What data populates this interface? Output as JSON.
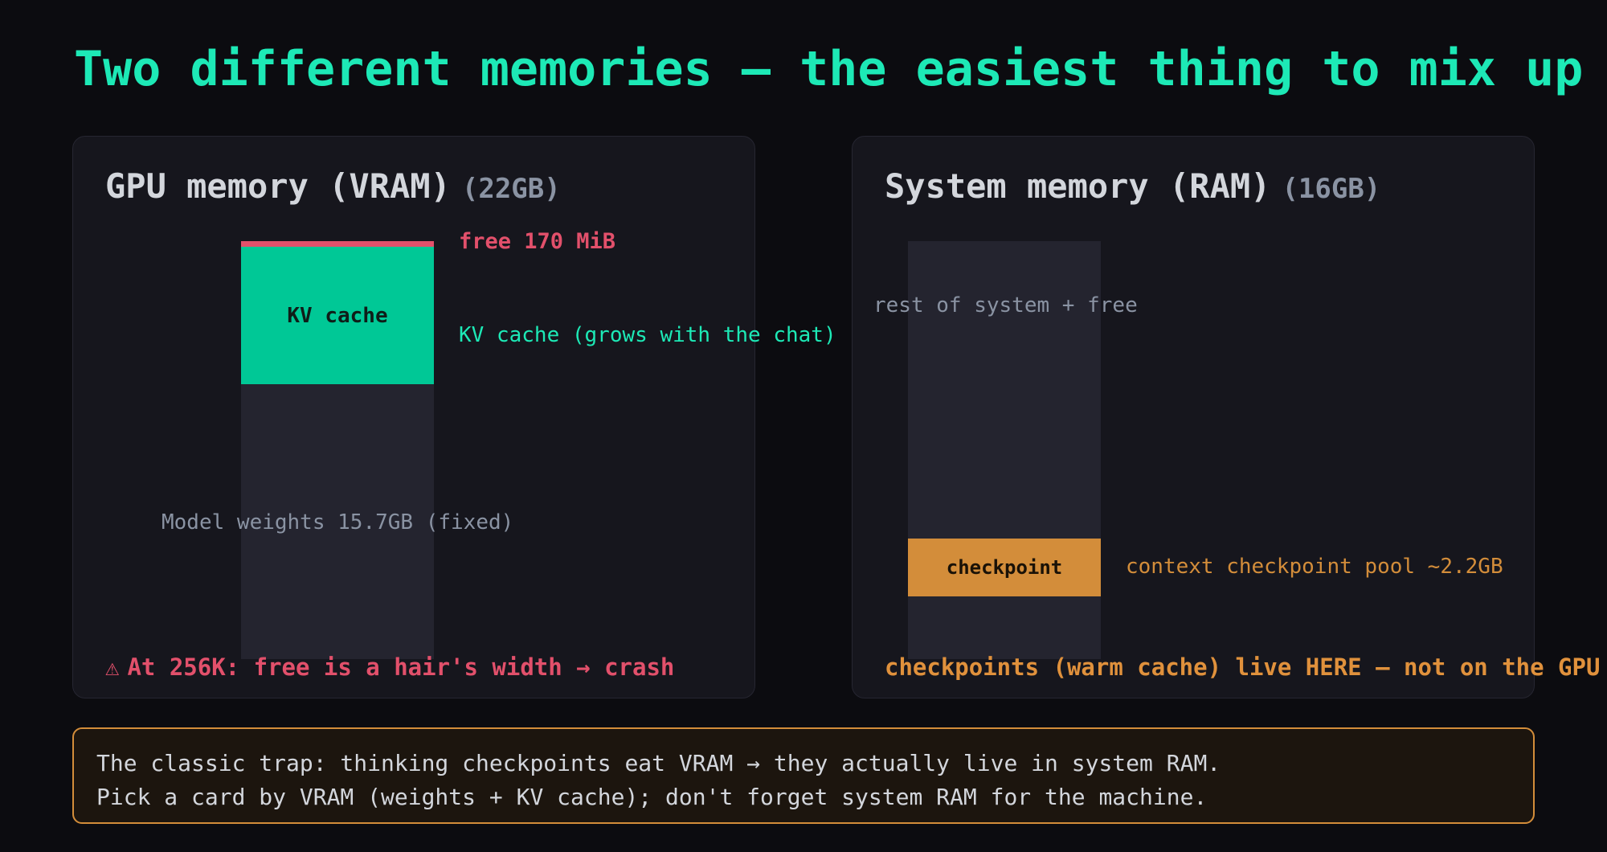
{
  "title": "Two different memories — the easiest thing to mix up",
  "vram": {
    "heading": "GPU memory (VRAM)",
    "size": "(22GB)",
    "free_label": "free 170 MiB",
    "kv_block_label": "KV cache",
    "kv_label": "KV cache (grows with the chat)",
    "weights_label": "Model weights 15.7GB (fixed)",
    "warning": "At 256K: free is a hair's width → crash",
    "warning_icon": "⚠"
  },
  "ram": {
    "heading": "System memory (RAM)",
    "size": "(16GB)",
    "rest_label": "rest of system + free",
    "checkpoint_block_label": "checkpoint",
    "checkpoint_label": "context checkpoint pool ~2.2GB",
    "note": "checkpoints (warm cache) live HERE — not on the GPU"
  },
  "callout": {
    "line1": "The classic trap: thinking checkpoints eat VRAM → they actually live in system RAM.",
    "line2": "Pick a card by VRAM (weights + KV cache); don't forget system RAM for the machine."
  },
  "colors": {
    "accent": "#1de9b6",
    "kv_cache": "#00c896",
    "free": "#e2506b",
    "checkpoint": "#d38d3a"
  }
}
